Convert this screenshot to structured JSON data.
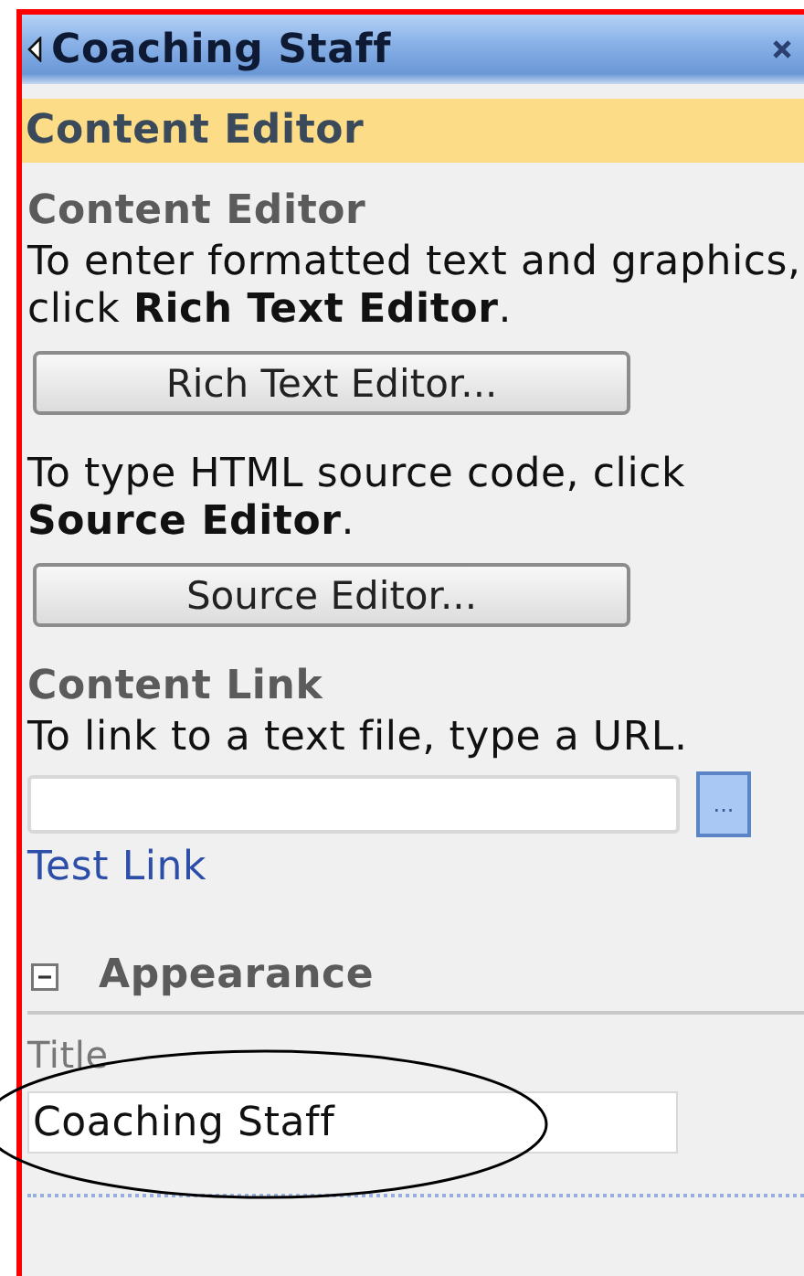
{
  "panel": {
    "title": "Coaching Staff"
  },
  "header": "Content Editor",
  "content_editor": {
    "heading": "Content Editor",
    "blocks": [
      {
        "text": "To enter formatted text and graphics, click **Rich Text Editor**.",
        "button": "Rich Text Editor..."
      },
      {
        "text": "To type HTML source code, click **Source Editor**.",
        "button": "Source Editor..."
      }
    ]
  },
  "content_link": {
    "heading": "Content Link",
    "instruction": "To link to a text file, type a URL.",
    "browse_button": "...",
    "test_link": "Test Link"
  },
  "appearance": {
    "heading": "Appearance",
    "expanded": true,
    "fields": [
      {
        "label": "Title",
        "value": "Coaching Staff"
      }
    ]
  }
}
